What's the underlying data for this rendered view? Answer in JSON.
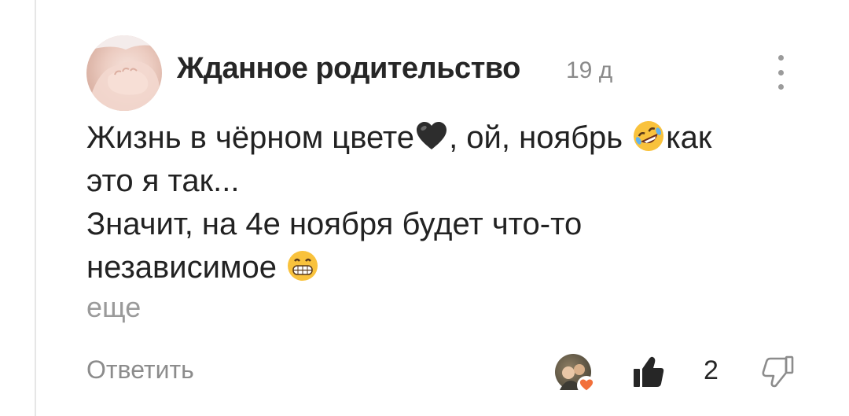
{
  "comment": {
    "author": "Жданное родительство",
    "time": "19 д",
    "body_lines": [
      {
        "before": "Жизнь в чёрном цвете",
        "emoji_1": "black-heart",
        "middle": ", ой, ноябрь ",
        "emoji_2": "rofl",
        "after": "как"
      },
      {
        "text": "это я так..."
      },
      {
        "text": "Значит, на 4е ноября будет что-то"
      },
      {
        "before": "независимое ",
        "emoji": "grinning"
      }
    ],
    "more_label": "еще",
    "reply_label": "Ответить",
    "like_count": "2"
  },
  "icons": {
    "menu": "more-vertical-icon",
    "like": "thumbs-up-icon",
    "dislike": "thumbs-down-icon",
    "reaction": "heart-icon"
  },
  "colors": {
    "text": "#222222",
    "muted": "#8c8c8c",
    "heart": "#f26f3a",
    "emoji_yellow": "#f9c23c"
  }
}
